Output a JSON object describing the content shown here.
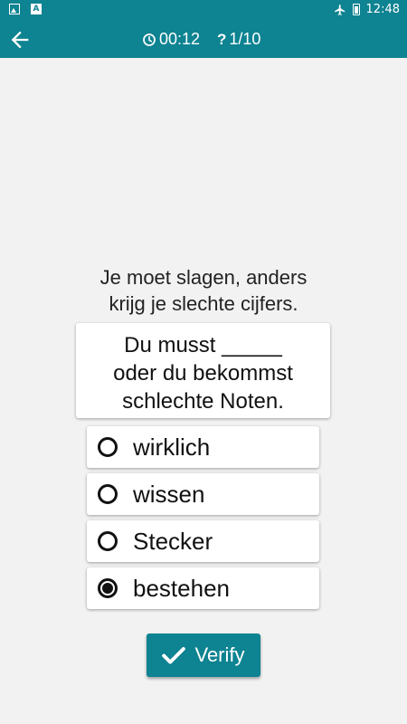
{
  "status_bar": {
    "time": "12:48",
    "icons": [
      "image-icon",
      "a-badge-icon",
      "airplane-icon",
      "battery-icon"
    ]
  },
  "app_bar": {
    "timer": "00:12",
    "question_counter": "1/10"
  },
  "question": {
    "prompt_lines": [
      "Je moet slagen, anders",
      "krijg je slechte cijfers."
    ],
    "sentence_lines": [
      "Du musst _____",
      "oder du bekommst",
      "schlechte Noten."
    ]
  },
  "options": [
    {
      "label": "wirklich",
      "selected": false
    },
    {
      "label": "wissen",
      "selected": false
    },
    {
      "label": "Stecker",
      "selected": false
    },
    {
      "label": "bestehen",
      "selected": true
    }
  ],
  "verify_button": {
    "label": "Verify"
  },
  "colors": {
    "primary": "#0e8391",
    "background": "#f2f2f2",
    "text": "#111111"
  }
}
